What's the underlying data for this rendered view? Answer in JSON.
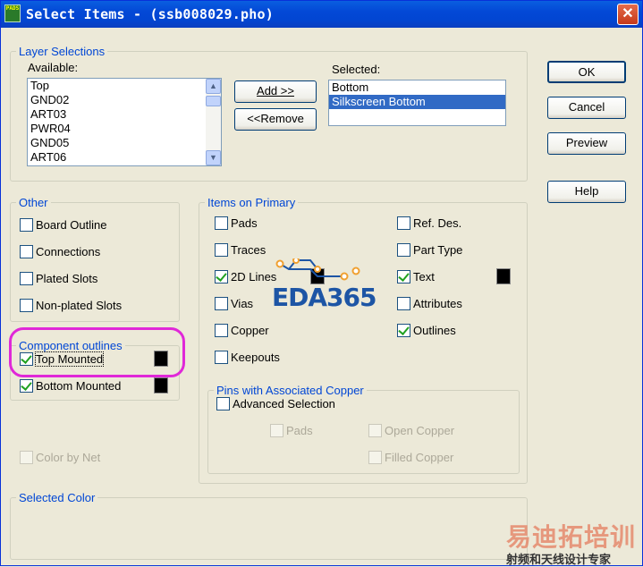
{
  "window": {
    "title": "Select Items - (ssb008029.pho)",
    "app_icon_text": "PADS",
    "close_glyph": "✕"
  },
  "layer_selections": {
    "legend": "Layer Selections",
    "available_label": "Available:",
    "available_items": [
      "Top",
      "GND02",
      "ART03",
      "PWR04",
      "GND05",
      "ART06"
    ],
    "selected_label": "Selected:",
    "selected_items": [
      "Bottom",
      "Silkscreen Bottom"
    ],
    "selected_highlight": "Silkscreen Bottom",
    "add_button": "Add >>",
    "remove_button": "<<Remove"
  },
  "dialog_buttons": {
    "ok": "OK",
    "cancel": "Cancel",
    "preview": "Preview",
    "help": "Help"
  },
  "other": {
    "legend": "Other",
    "items": [
      {
        "label": "Board Outline",
        "checked": false
      },
      {
        "label": "Connections",
        "checked": false
      },
      {
        "label": "Plated Slots",
        "checked": false
      },
      {
        "label": "Non-plated Slots",
        "checked": false
      }
    ]
  },
  "component_outlines": {
    "legend": "Component outlines",
    "top_mounted": {
      "label": "Top Mounted",
      "checked": true,
      "color": "#000000"
    },
    "bottom_mounted": {
      "label": "Bottom Mounted",
      "checked": true,
      "color": "#000000"
    }
  },
  "color_by_net": {
    "label": "Color by Net",
    "checked": false,
    "disabled": true
  },
  "items_on_primary": {
    "legend": "Items on Primary",
    "left": [
      {
        "label": "Pads",
        "checked": false
      },
      {
        "label": "Traces",
        "checked": false
      },
      {
        "label": "2D Lines",
        "checked": true
      },
      {
        "label": "Vias",
        "checked": false
      },
      {
        "label": "Copper",
        "checked": false
      },
      {
        "label": "Keepouts",
        "checked": false
      }
    ],
    "right": [
      {
        "label": "Ref. Des.",
        "checked": false
      },
      {
        "label": "Part Type",
        "checked": false
      },
      {
        "label": "Text",
        "checked": true
      },
      {
        "label": "Attributes",
        "checked": false
      },
      {
        "label": "Outlines",
        "checked": true
      }
    ],
    "text_color": "#000000",
    "lines_color": "#000000"
  },
  "pins_copper": {
    "legend": "Pins with Associated Copper",
    "advanced_selection": {
      "label": "Advanced Selection",
      "checked": false
    },
    "pads": {
      "label": "Pads",
      "disabled": true
    },
    "open_copper": {
      "label": "Open Copper",
      "disabled": true
    },
    "filled_copper": {
      "label": "Filled Copper",
      "disabled": true
    }
  },
  "selected_color": {
    "legend": "Selected Color"
  },
  "watermark": {
    "logo_text": "EDA365",
    "brand": "易迪拓培训",
    "tagline": "射频和天线设计专家"
  },
  "colors": {
    "accent": "#0046d5",
    "highlight_ring": "#e028d8",
    "selection": "#316ac5"
  }
}
